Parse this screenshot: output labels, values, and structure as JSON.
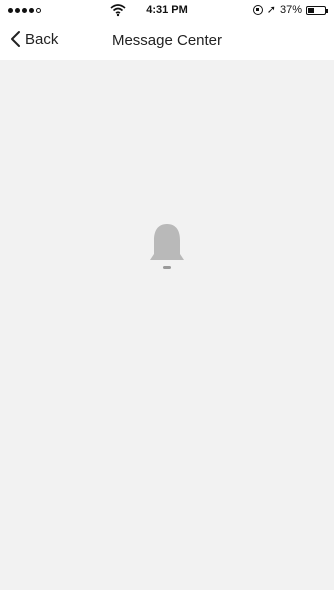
{
  "status_bar": {
    "time": "4:31 PM",
    "battery_text": "37%",
    "battery_level": 0.37,
    "signal_bars_filled": 4,
    "signal_bars_total": 5
  },
  "nav": {
    "back_label": "Back",
    "title": "Message Center"
  },
  "empty_state": {
    "icon": "bell-icon",
    "text": ""
  }
}
